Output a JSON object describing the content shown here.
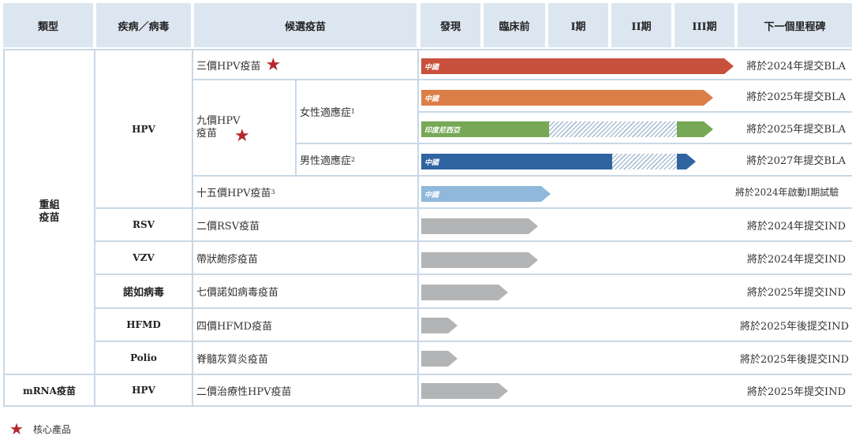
{
  "header": {
    "category": "類型",
    "disease": "疾病／病毒",
    "candidate": "候選疫苗",
    "discovery": "發現",
    "preclinical": "臨床前",
    "phase1": "I期",
    "phase2": "II期",
    "phase3": "III期",
    "milestone": "下一個里程碑"
  },
  "categories": {
    "recombinant": "重組\n疫苗",
    "mrna": "mRNA疫苗"
  },
  "diseases": {
    "hpv": "HPV",
    "rsv": "RSV",
    "vzv": "VZV",
    "norovirus": "諾如病毒",
    "hfmd": "HFMD",
    "polio": "Polio",
    "mrna_hpv": "HPV"
  },
  "candidates": {
    "hpv3": "三價HPV疫苗",
    "hpv9_line1": "九價HPV",
    "hpv9_line2": "疫苗",
    "female": "女性適應症",
    "female_sup": "1",
    "male": "男性適應症",
    "male_sup": "2",
    "hpv15": "十五價HPV疫苗",
    "hpv15_sup": "3",
    "rsv": "二價RSV疫苗",
    "vzv": "帶狀皰疹疫苗",
    "norovirus": "七價諾如病毒疫苗",
    "hfmd": "四價HFMD疫苗",
    "polio": "脊髓灰質炎疫苗",
    "mrna_hpv": "二價治療性HPV疫苗"
  },
  "bar_labels": {
    "hpv3": "中國",
    "hpv9_female_cn": "中國",
    "hpv9_female_in": "印度尼西亞",
    "hpv9_male": "中國",
    "hpv15": "中國"
  },
  "milestones": {
    "hpv3": "將於2024年提交BLA",
    "hpv9_female_cn": "將於2025年提交BLA",
    "hpv9_female_in": "將於2025年提交BLA",
    "hpv9_male": "將於2027年提交BLA",
    "hpv15": "將於2024年啟動I期試驗",
    "rsv": "將於2024年提交IND",
    "vzv": "將於2024年提交IND",
    "norovirus": "將於2025年提交IND",
    "hfmd": "將於2025年後提交IND",
    "polio": "將於2025年後提交IND",
    "mrna_hpv": "將於2025年提交IND"
  },
  "legend": {
    "core_product": "核心產品"
  },
  "colors": {
    "red": "#c8503c",
    "orange": "#dc7e48",
    "green": "#76a856",
    "blue": "#2f64a0",
    "light_blue": "#90b8da",
    "gray": "#b3b4b6",
    "header_bg": "#dbe6f0",
    "star": "#b5282f"
  }
}
